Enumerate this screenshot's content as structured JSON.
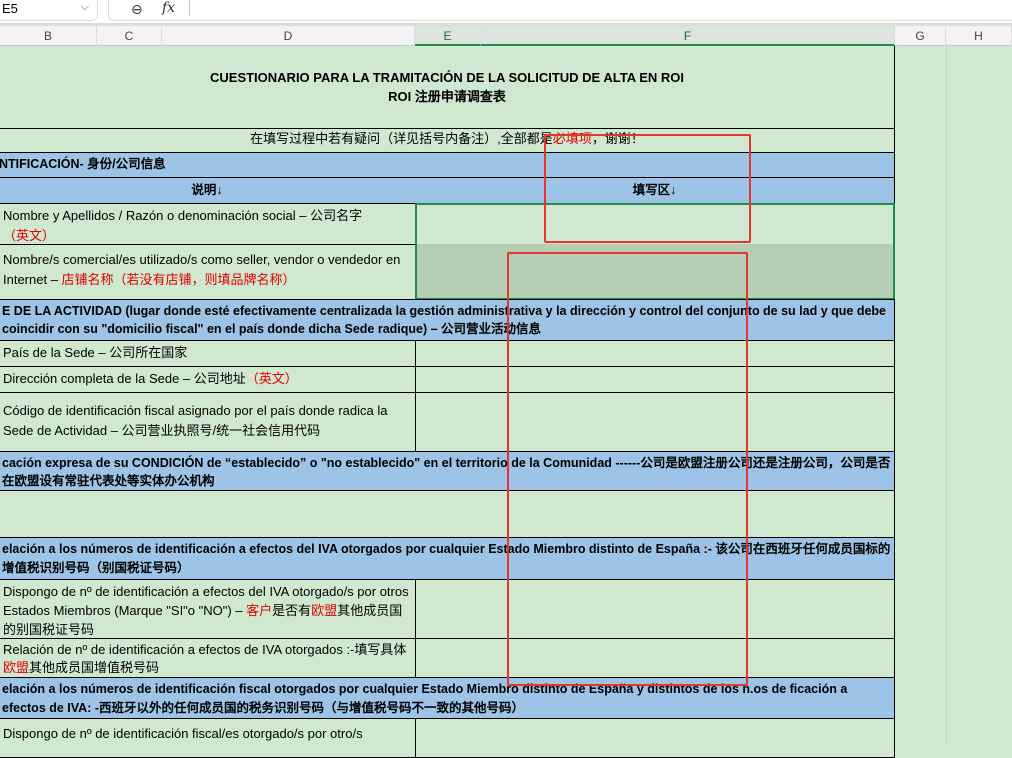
{
  "formula_bar": {
    "cell_ref": "E5",
    "zoom_icon": "zoom-icon",
    "fx_label": "fx",
    "value": ""
  },
  "columns": [
    "B",
    "C",
    "D",
    "E",
    "F",
    "G",
    "H"
  ],
  "sheet": {
    "title": "CUESTIONARIO PARA LA TRAMITACIÓN DE LA SOLICITUD DE ALTA EN ROI",
    "subtitle": "ROI 注册申请调查表",
    "note_a": "在填写过程中若有疑问（详见括号内备注）,全部都是",
    "note_red": "必填项",
    "note_b": "，谢谢！",
    "section1": "NTIFICACIÓN- 身份/公司信息",
    "hdr_desc": "说明↓",
    "hdr_fill": "填写区↓",
    "r1a": "Nombre y Apellidos / Razón o denominación social – 公司名字",
    "r1b": "（英文）",
    "r2a": "Nombre/s comercial/es utilizado/s como seller, vendor o vendedor en Internet – ",
    "r2b": "店铺名称（若没有店铺，则填品牌名称）",
    "section2": "E DE LA ACTIVIDAD (lugar donde esté efectivamente centralizada la gestión administrativa y la dirección y control del conjunto de su lad y que debe coincidir con su \"domicilio fiscal\" en el país donde dicha Sede radique) – 公司营业活动信息",
    "r3": "País de la Sede – 公司所在国家",
    "r4a": "Dirección completa de la Sede – 公司地址",
    "r4b": "（英文）",
    "r5": "Código de identificación fiscal asignado por el país donde radica la Sede de Actividad – 公司营业执照号/统一社会信用代码",
    "section3": "cación expresa de su CONDICIÓN de “establecido” o \"no establecido\" en el territorio de la Comunidad ------公司是欧盟注册公司还是注册公司，公司是否在欧盟设有常驻代表处等实体办公机构",
    "section4": "elación a los números de identificación a efectos del IVA otorgados por cualquier Estado Miembro distinto de España :- 该公司在西班牙任何成员国标的增值税识别号码（别国税证号码）",
    "r6a": "Dispongo de nº de identificación a efectos del IVA otorgado/s por otros Estados Miembros (Marque \"SI\"o \"NO\") – ",
    "r6b": "客户",
    "r6c": "是否有",
    "r6d": "欧盟",
    "r6e": "其他成员国的别国税证号码",
    "r7a": "Relación de nº de identificación a efectos de IVA otorgados :-填写具体",
    "r7b": "欧盟",
    "r7c": "其他成员国增值税号码",
    "section5": "elación a los números de identificación fiscal otorgados por cualquier Estado Miembro distinto de España y distintos de los n.os de ficación a efectos de IVA:  -西班牙以外的任何成员国的税务识别号码（与增值税号码不一致的其他号码）",
    "r8": "Dispongo de nº de identificación fiscal/es otorgado/s por otro/s"
  },
  "colors": {
    "green_bg": "#cfe8cf",
    "blue": "#9dc3e6",
    "red": "#e00000",
    "selection": "#1e8c4e"
  }
}
